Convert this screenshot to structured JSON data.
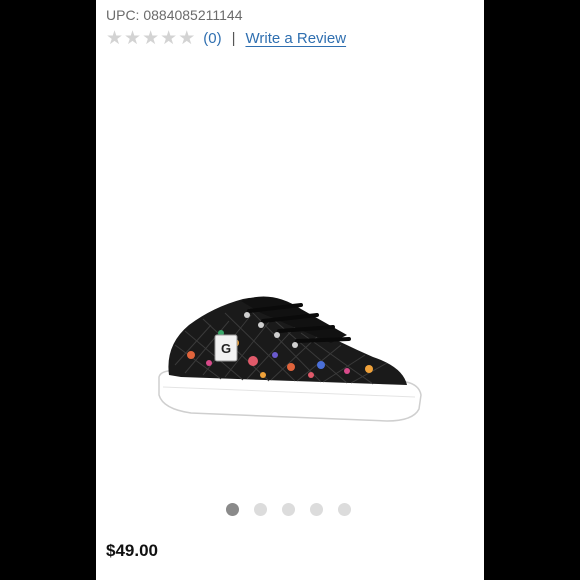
{
  "product": {
    "upc_label": "UPC: 0884085211144",
    "rating": {
      "filled_stars": 0,
      "max_stars": 5,
      "star_glyph": "★",
      "count_text": "(0)",
      "separator": "|",
      "write_review_label": "Write a Review"
    },
    "image": {
      "description_icon": "sneaker-image",
      "logo_letter": "G",
      "colors": {
        "upper": "#1a1a1a",
        "sole": "#ffffff",
        "laces": "#111111"
      }
    },
    "carousel": {
      "total": 5,
      "active_index": 0
    },
    "price": "$49.00"
  },
  "colors": {
    "link": "#2f6fb0",
    "star_empty": "#d3d3d3",
    "dot_active": "#8a8a8a",
    "dot_inactive": "#dcdcdc"
  }
}
